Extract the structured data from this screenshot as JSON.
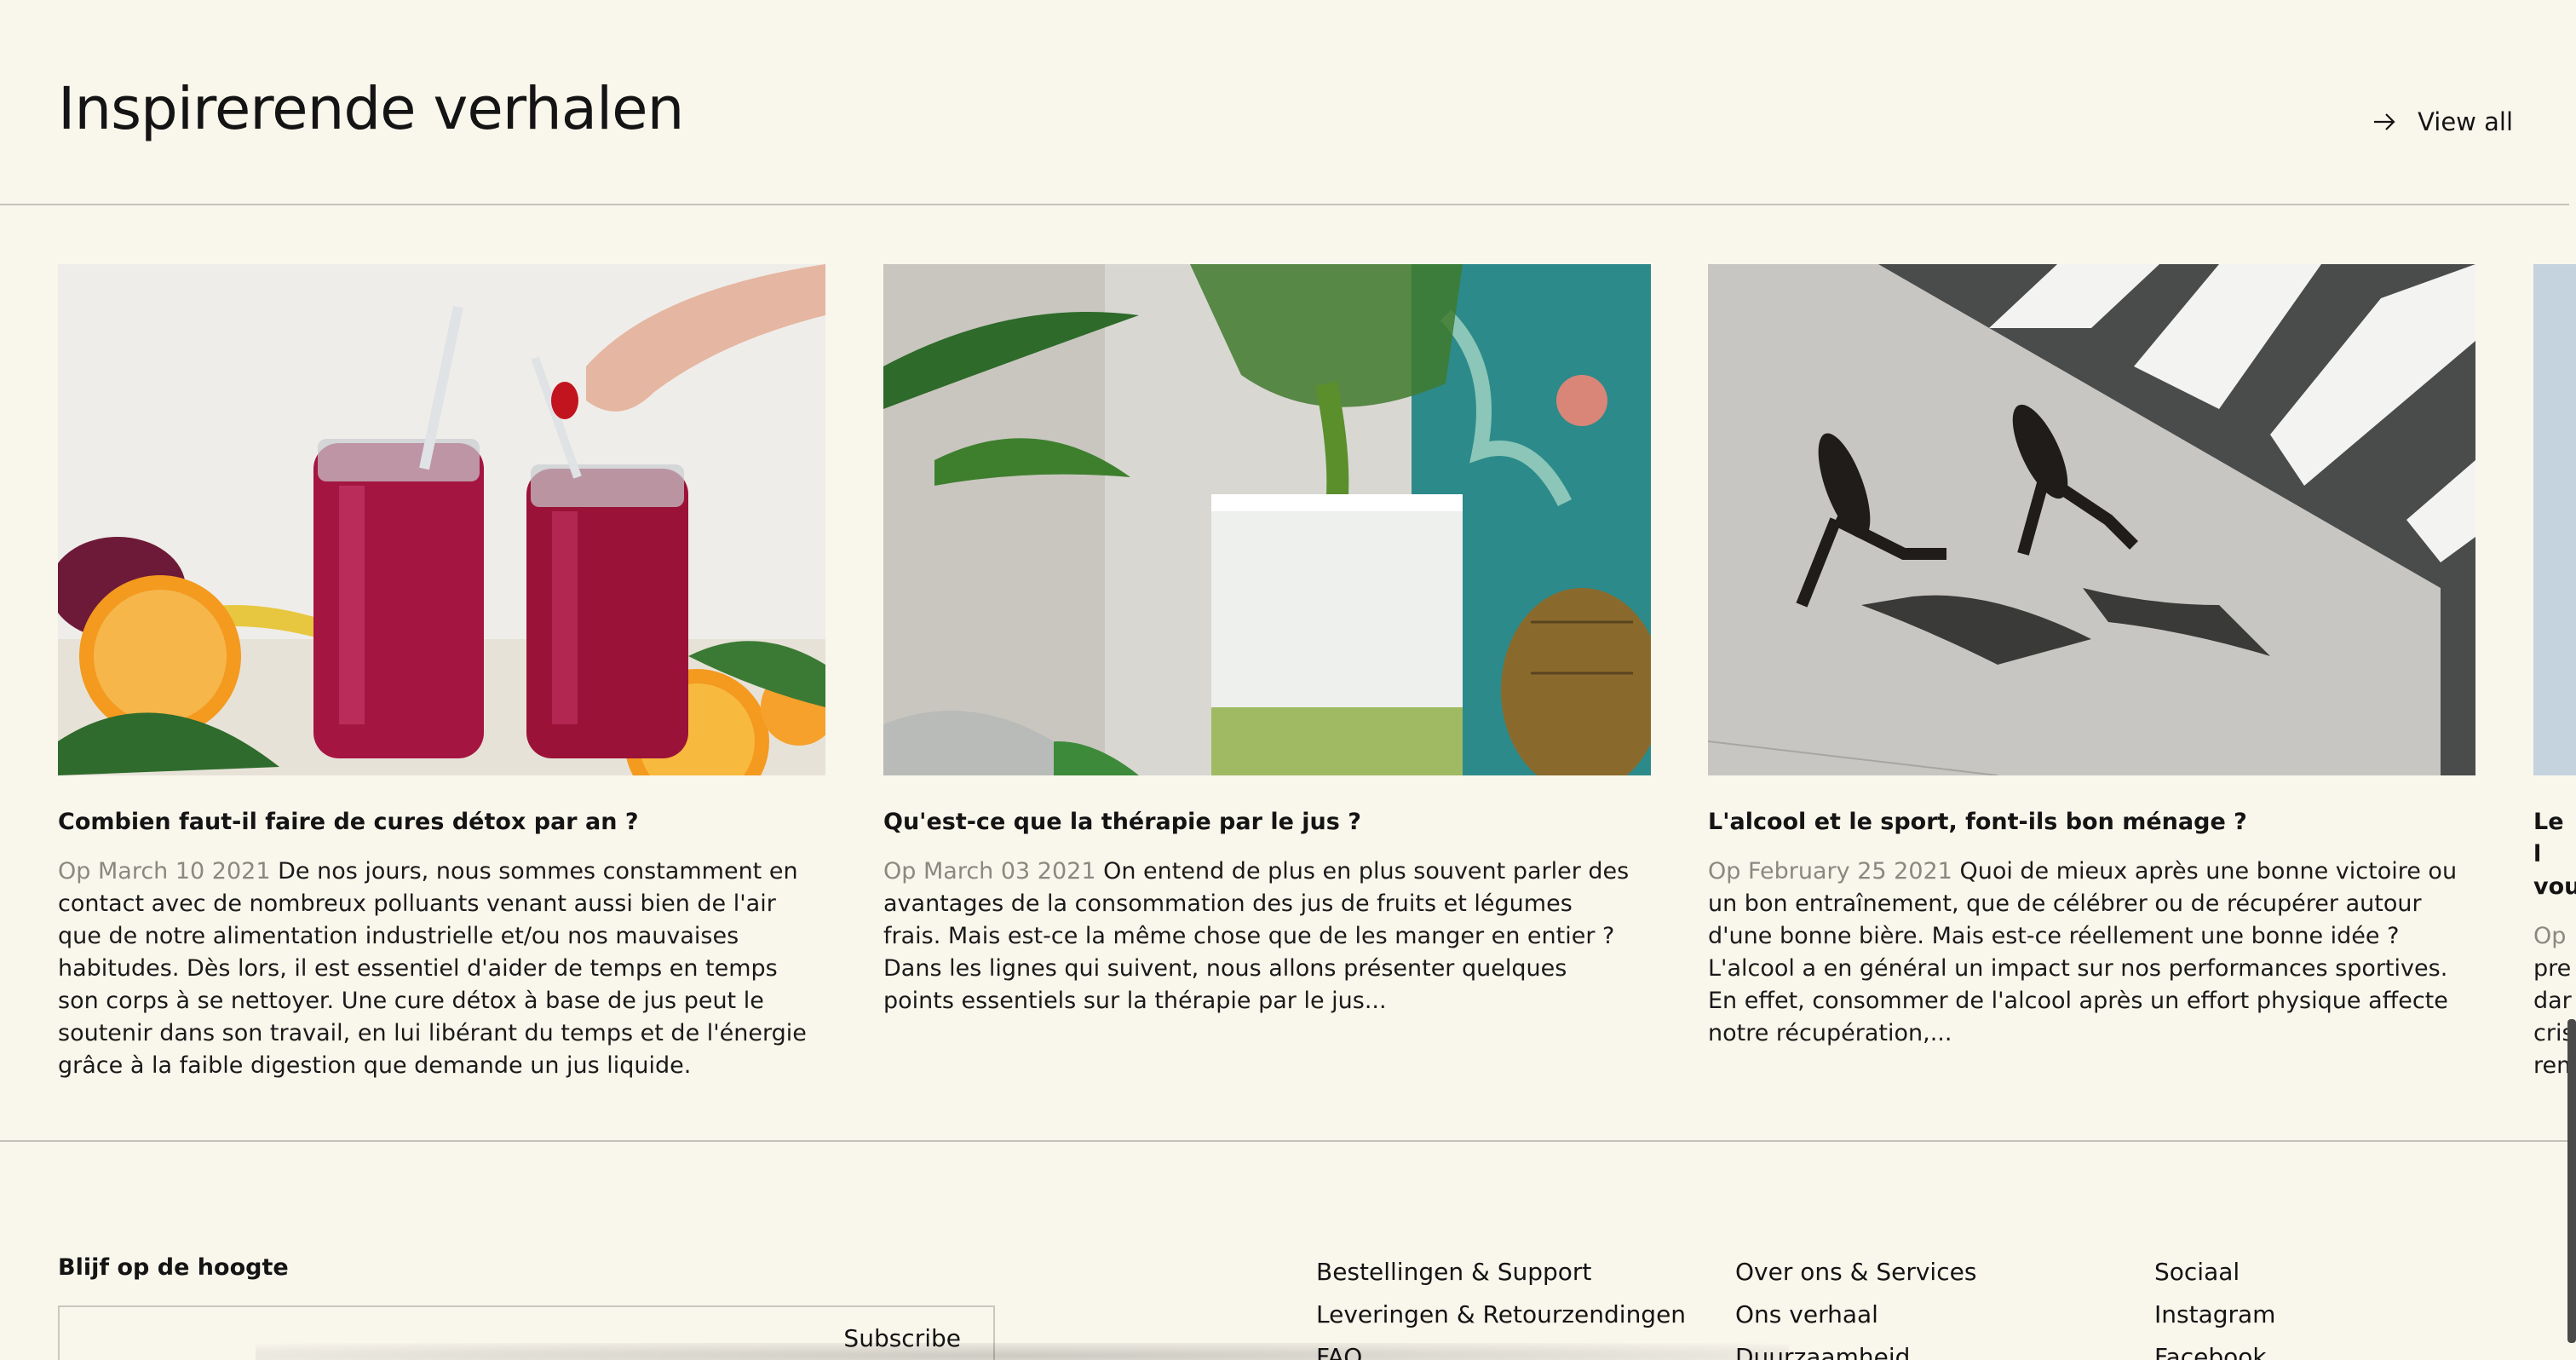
{
  "section": {
    "title": "Inspirerende verhalen",
    "view_all_label": "View all"
  },
  "stories": [
    {
      "title": "Combien faut-il faire de cures détox par an ?",
      "date": "Op March 10 2021",
      "excerpt": "De nos jours, nous sommes constamment en contact avec de nombreux polluants venant aussi bien de l'air que de notre alimentation industrielle et/ou nos mauvaises habitudes. Dès lors, il est essentiel d'aider de temps en temps son corps à se nettoyer. Une cure détox à base de jus peut le soutenir dans son travail, en lui libérant du temps et de l'énergie grâce à la faible digestion que demande un jus liquide."
    },
    {
      "title": "Qu'est-ce que la thérapie par le jus ?",
      "date": "Op March 03 2021",
      "excerpt": "On entend de plus en plus souvent parler des avantages de la consommation des jus de fruits et légumes frais. Mais est-ce la même chose que de les manger en entier ? Dans les lignes qui suivent, nous allons présenter quelques points essentiels sur la thérapie par le jus..."
    },
    {
      "title": "L'alcool et le sport, font-ils bon ménage ?",
      "date": "Op February 25 2021",
      "excerpt": "Quoi de mieux après une bonne victoire ou un bon entraînement, que de célébrer ou de récupérer autour d'une bonne bière. Mais est-ce réellement une bonne idée ? L'alcool a en général un impact sur nos performances sportives. En effet, consommer de l'alcool après un effort physique affecte notre récupération,..."
    },
    {
      "title": "Le l vou",
      "date": "Op",
      "excerpt": "pre dar cris rem"
    }
  ],
  "footer": {
    "newsletter_label": "Blijf op de hoogte",
    "subscribe_placeholder": "",
    "subscribe_label": "Subscribe",
    "col1": [
      "Bestellingen & Support",
      "Leveringen & Retourzendingen",
      "FAQ"
    ],
    "col2": [
      "Over ons & Services",
      "Ons verhaal",
      "Duurzaamheid"
    ],
    "col3": [
      "Sociaal",
      "Instagram",
      "Facebook"
    ]
  }
}
